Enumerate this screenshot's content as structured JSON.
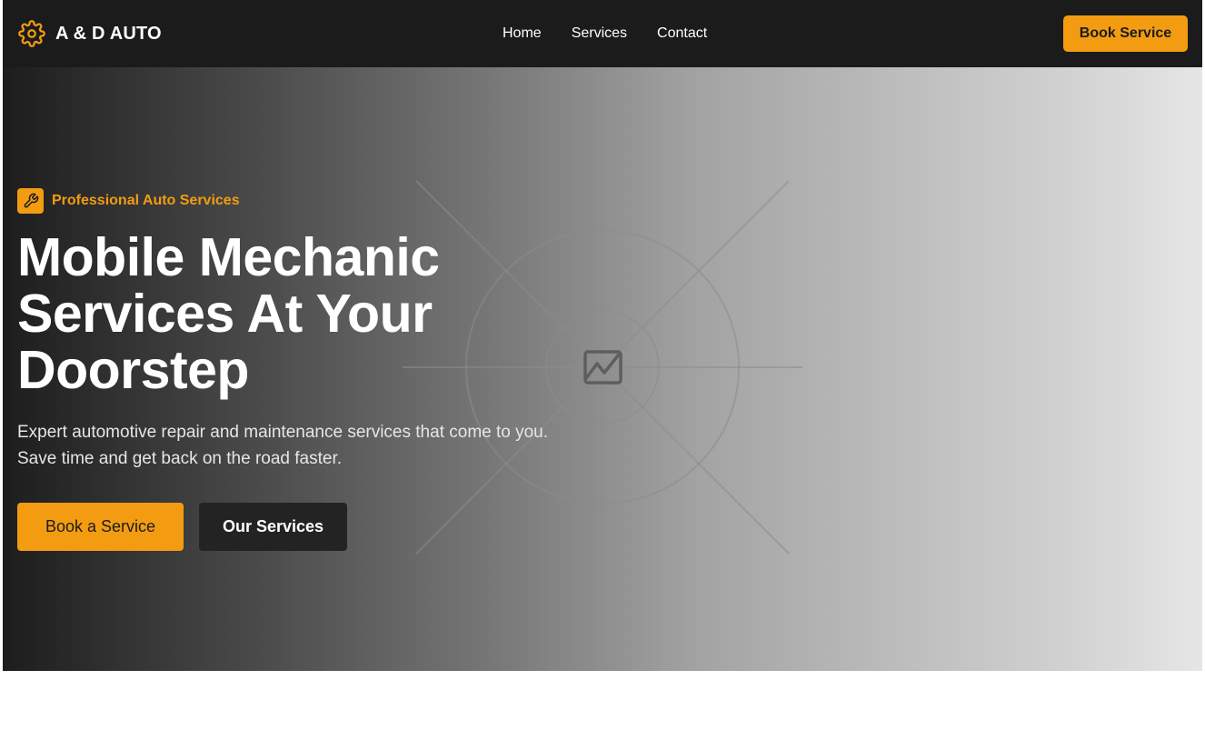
{
  "brand": {
    "name": "A & D AUTO",
    "icon": "gear-icon"
  },
  "nav": {
    "links": [
      {
        "label": "Home"
      },
      {
        "label": "Services"
      },
      {
        "label": "Contact"
      }
    ],
    "cta_label": "Book Service"
  },
  "hero": {
    "eyebrow": {
      "icon": "wrench-icon",
      "label": "Professional Auto Services"
    },
    "title_lines": [
      "Mobile Mechanic",
      "Services At Your",
      "Doorstep"
    ],
    "description_lines": [
      "Expert automotive repair and maintenance services that come to you.",
      "Save time and get back on the road faster."
    ],
    "primary_button": "Book a Service",
    "secondary_button": "Our Services",
    "image_placeholder_icon": "image-icon"
  },
  "colors": {
    "accent": "#f39c12",
    "nav_background": "#1b1b1b",
    "secondary_button_background": "#232323"
  }
}
